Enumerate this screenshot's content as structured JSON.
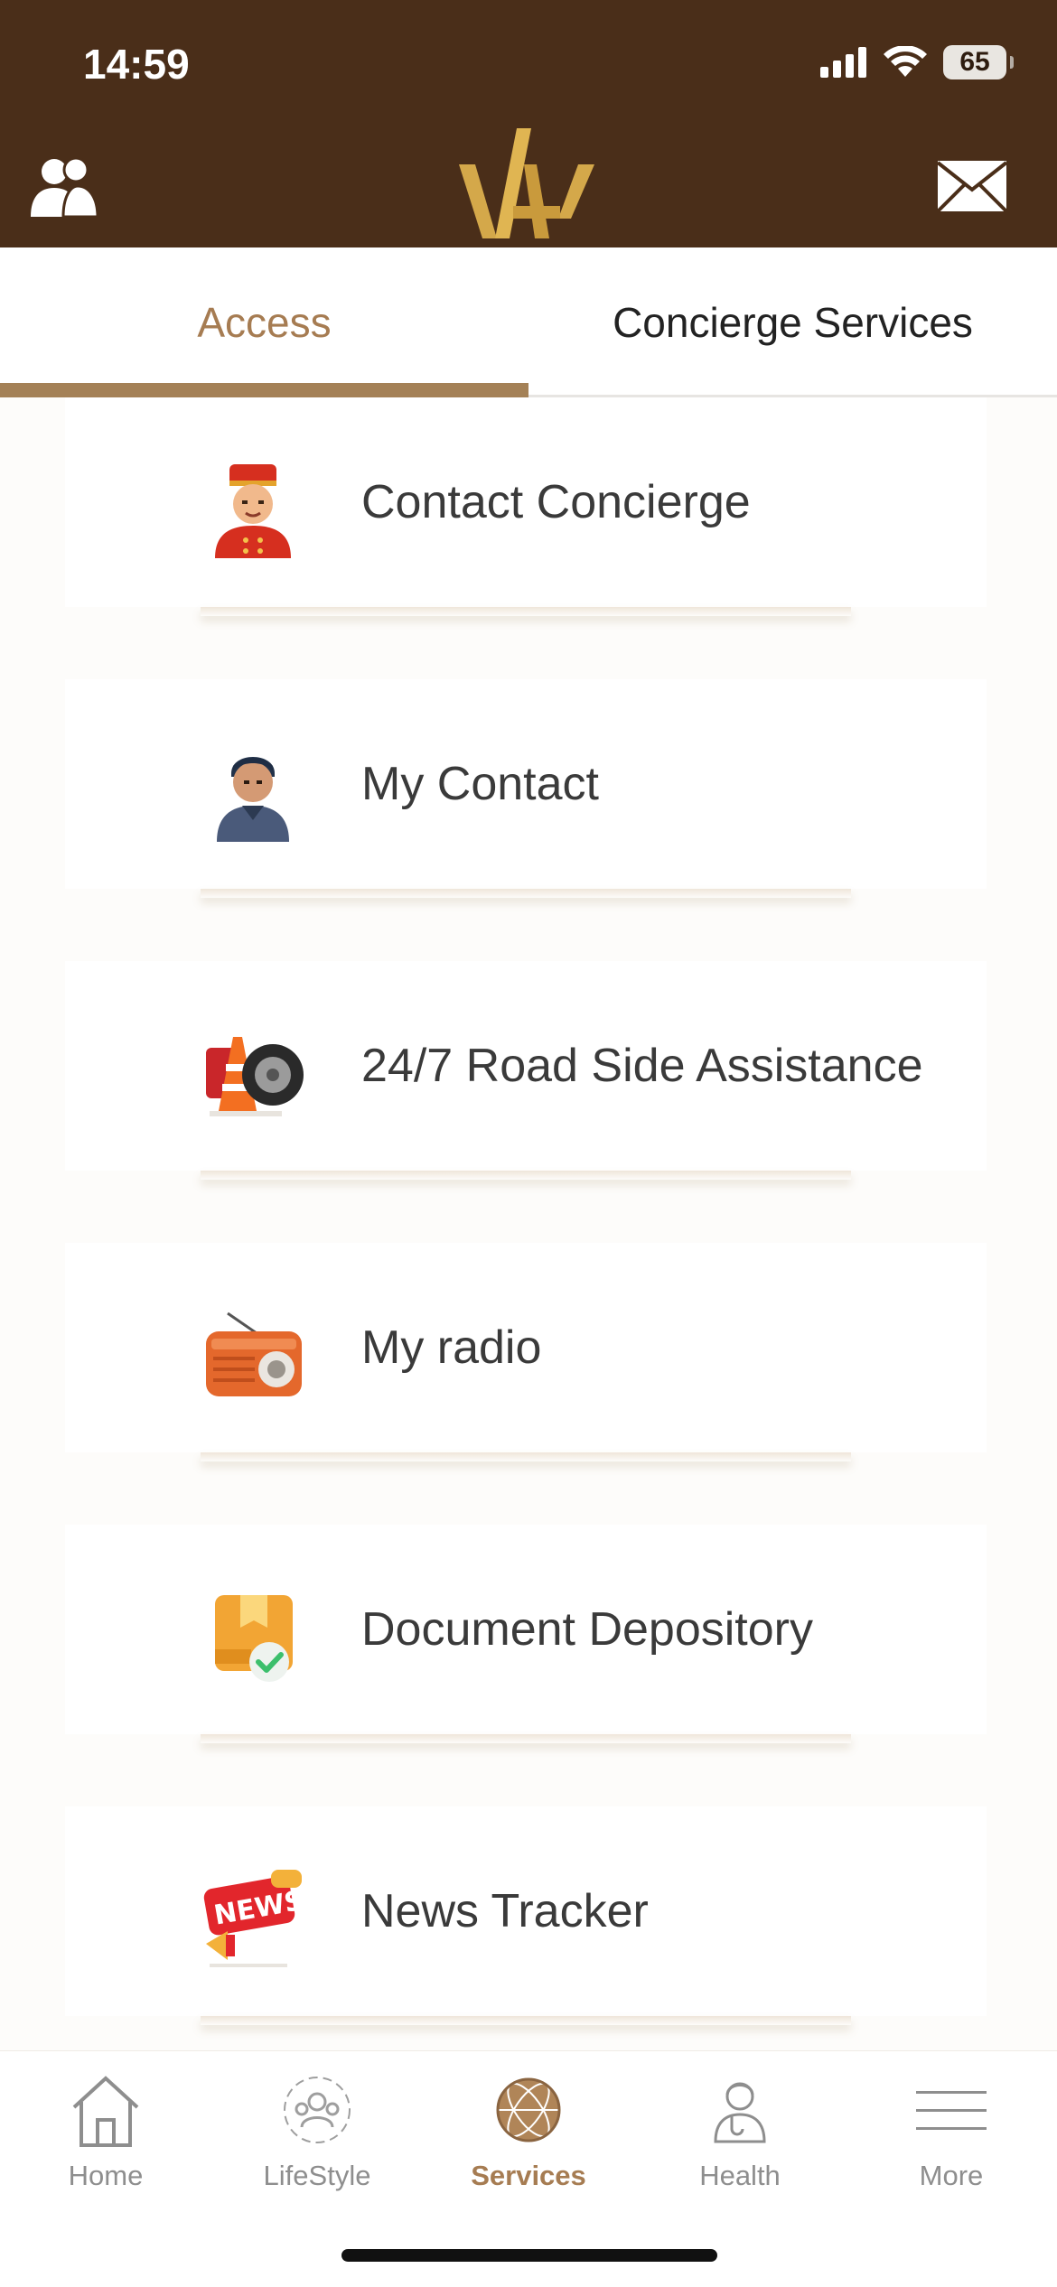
{
  "status_bar": {
    "time": "14:59",
    "battery": "65"
  },
  "header": {
    "profile_icon": "profile-icon",
    "logo": "brand-logo",
    "mail_icon": "mail-icon"
  },
  "tabs": [
    {
      "label": "Access",
      "active": true
    },
    {
      "label": "Concierge Services",
      "active": false
    }
  ],
  "services": [
    {
      "label": "Contact Concierge",
      "icon": "bellboy-icon"
    },
    {
      "label": "My Contact",
      "icon": "person-icon"
    },
    {
      "label": "24/7 Road Side Assistance",
      "icon": "roadside-icon"
    },
    {
      "label": "My radio",
      "icon": "radio-icon"
    },
    {
      "label": "Document Depository",
      "icon": "document-box-icon"
    },
    {
      "label": "News Tracker",
      "icon": "news-icon"
    }
  ],
  "bottom_nav": [
    {
      "label": "Home",
      "icon": "home-icon",
      "active": false
    },
    {
      "label": "LifeStyle",
      "icon": "lifestyle-icon",
      "active": false
    },
    {
      "label": "Services",
      "icon": "globe-icon",
      "active": true
    },
    {
      "label": "Health",
      "icon": "doctor-icon",
      "active": false
    },
    {
      "label": "More",
      "icon": "menu-icon",
      "active": false
    }
  ],
  "colors": {
    "header_bg": "#4a2e19",
    "accent": "#a67c52",
    "tab_indicator": "#a48157"
  }
}
